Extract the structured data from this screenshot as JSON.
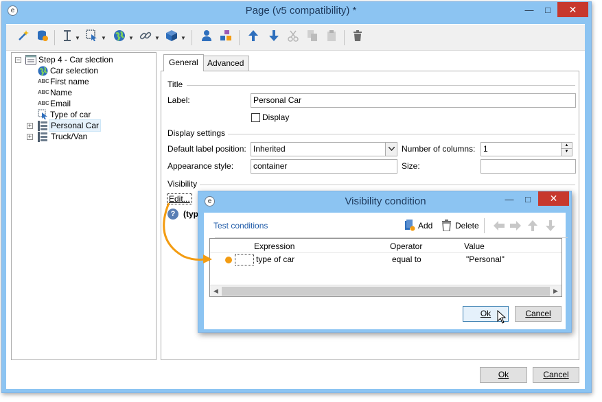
{
  "main_window": {
    "title": "Page (v5 compatibility) *",
    "app_icon_glyph": "e",
    "minimize_glyph": "—",
    "maximize_glyph": "□",
    "close_glyph": "✕"
  },
  "toolbar": {
    "icons": [
      "wand-icon",
      "database-refresh-icon",
      "insert-field-icon",
      "insert-control-icon",
      "globe-icon",
      "link-icon",
      "box-icon",
      "person-icon",
      "components-icon",
      "move-up-icon",
      "move-down-icon",
      "cut-icon",
      "copy-icon",
      "paste-icon",
      "delete-icon"
    ]
  },
  "tree": {
    "root": "Step 4 - Car slection",
    "items": [
      {
        "label": "Car selection",
        "icon": "globe-icon"
      },
      {
        "label": "First name",
        "icon": "abc-icon",
        "abc": "ABC"
      },
      {
        "label": "Name",
        "icon": "abc-icon",
        "abc": "ABC"
      },
      {
        "label": "Email",
        "icon": "abc-icon",
        "abc": "ABC"
      },
      {
        "label": "Type of car",
        "icon": "cursor-select-icon"
      },
      {
        "label": "Personal Car",
        "icon": "container-icon"
      },
      {
        "label": "Truck/Van",
        "icon": "container-icon"
      }
    ],
    "expand_glyph": "+",
    "collapse_glyph": "−"
  },
  "tabs": [
    "General",
    "Advanced"
  ],
  "general": {
    "title_group": "Title",
    "label_label": "Label:",
    "label_value": "Personal Car",
    "display_label": "Display",
    "display_checked": false,
    "display_settings_group": "Display settings",
    "default_label_position_label": "Default label position:",
    "default_label_position_value": "Inherited",
    "number_of_columns_label": "Number of columns:",
    "number_of_columns_value": "1",
    "appearance_style_label": "Appearance style:",
    "appearance_style_value": "container",
    "size_label": "Size:",
    "size_value": "",
    "visibility_group": "Visibility",
    "edit_link": "Edit...",
    "condition_preview": "(typ",
    "help_glyph": "?"
  },
  "footer": {
    "ok": "Ok",
    "cancel": "Cancel"
  },
  "dialog": {
    "title": "Visibility condition",
    "minimize_glyph": "—",
    "maximize_glyph": "□",
    "close_glyph": "✕",
    "test_conditions": "Test conditions",
    "add": "Add",
    "delete": "Delete",
    "columns": [
      "Expression",
      "Operator",
      "Value"
    ],
    "rows": [
      {
        "expression": "type of car",
        "operator": "equal to",
        "value": "\"Personal\""
      }
    ],
    "ok": "Ok",
    "cancel": "Cancel"
  },
  "colors": {
    "accent_orange": "#f39c12",
    "title_blue": "#8cc4f2",
    "link_blue": "#1e5aa8"
  }
}
